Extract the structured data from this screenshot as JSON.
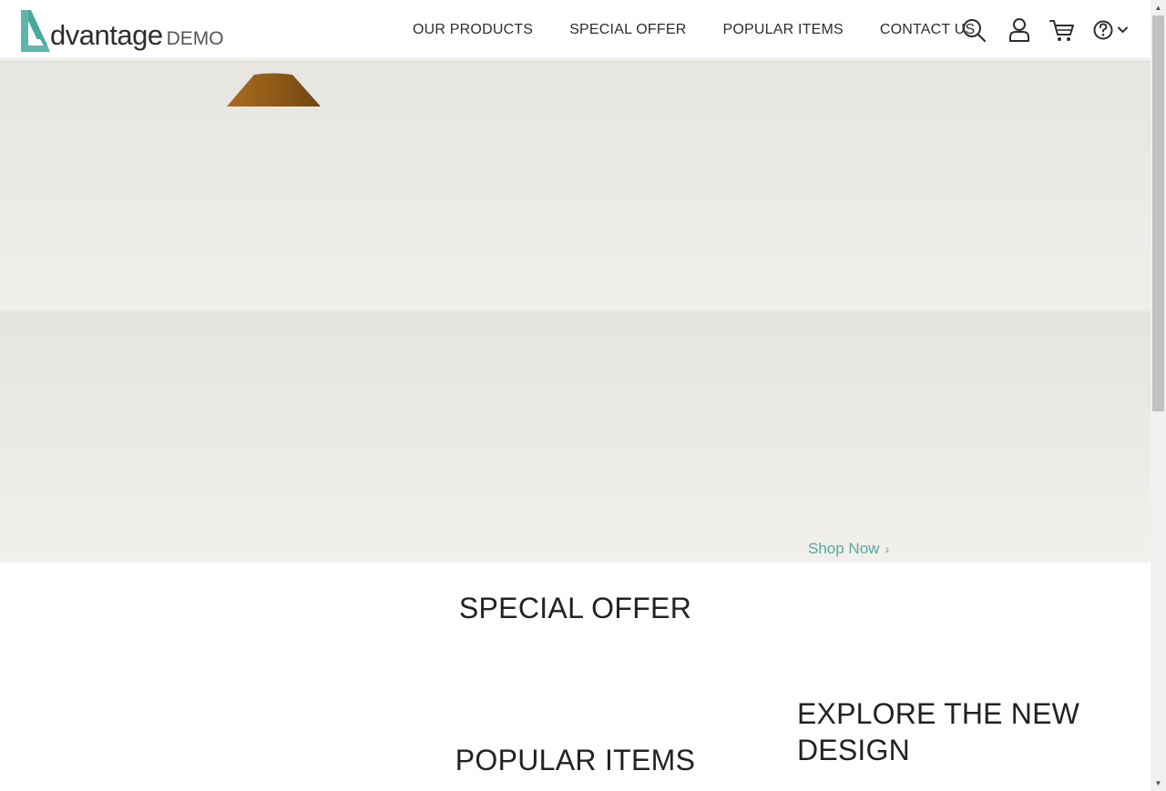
{
  "header": {
    "logo_main": "dvantage",
    "logo_demo": "DEMO",
    "nav": [
      "OUR PRODUCTS",
      "SPECIAL OFFER",
      "POPULAR ITEMS",
      "CONTACT US"
    ],
    "icons": [
      "search-icon",
      "user-icon",
      "cart-icon",
      "help-icon",
      "chevron-down-icon"
    ]
  },
  "hero": {
    "shop_now": "Shop Now",
    "chevron": "›"
  },
  "sections": {
    "special_offer": "SPECIAL OFFER",
    "popular_items": "POPULAR ITEMS",
    "explore_line1": "EXPLORE THE NEW",
    "explore_line2": "DESIGN"
  },
  "scrollbar": {
    "up": "▲",
    "down": "▼"
  },
  "colors": {
    "accent": "#5ba8a0",
    "text": "#2d2d2d",
    "lamp": "#8a5a1a"
  }
}
